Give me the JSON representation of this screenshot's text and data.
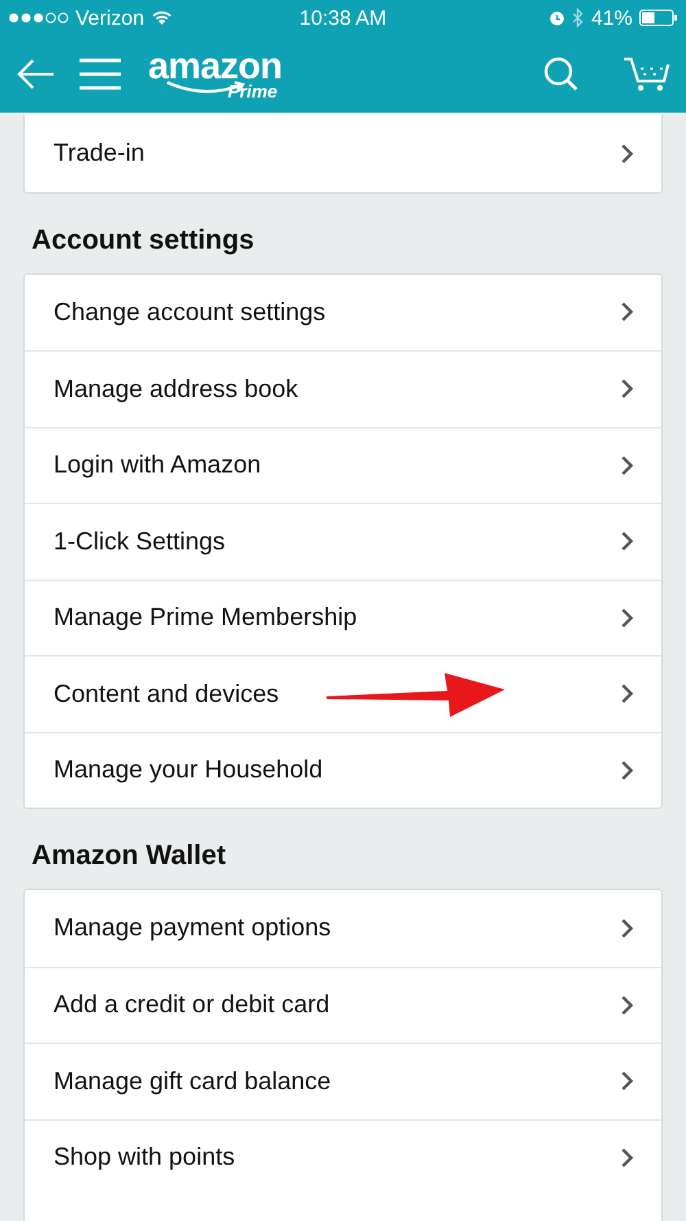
{
  "status_bar": {
    "carrier": "Verizon",
    "time": "10:38 AM",
    "battery": "41%"
  },
  "header": {
    "logo": "amazon",
    "logo_sub": "Prime"
  },
  "sections": [
    {
      "rows": [
        {
          "label": "Trade-in",
          "marked": false
        }
      ]
    },
    {
      "title": "Account settings",
      "rows": [
        {
          "label": "Change account settings",
          "marked": false
        },
        {
          "label": "Manage address book",
          "marked": false
        },
        {
          "label": "Login with Amazon",
          "marked": false
        },
        {
          "label": "1-Click Settings",
          "marked": false
        },
        {
          "label": "Manage Prime Membership",
          "marked": false
        },
        {
          "label": "Content and devices",
          "marked": true
        },
        {
          "label": "Manage your Household",
          "marked": false
        }
      ]
    },
    {
      "title": "Amazon Wallet",
      "rows": [
        {
          "label": "Manage payment options",
          "marked": false
        },
        {
          "label": "Add a credit or debit card",
          "marked": false
        },
        {
          "label": "Manage gift card balance",
          "marked": false
        },
        {
          "label": "Shop with points",
          "marked": false
        }
      ]
    }
  ]
}
